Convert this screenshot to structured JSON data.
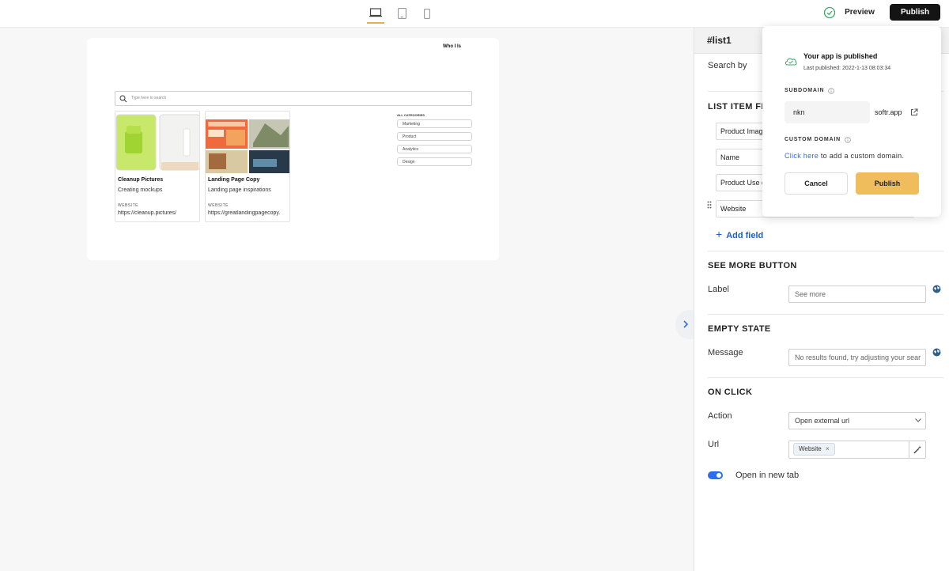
{
  "topbar": {
    "devices": [
      {
        "icon": "desktop-icon",
        "active": true
      },
      {
        "icon": "tablet-icon",
        "active": false
      },
      {
        "icon": "mobile-icon",
        "active": false
      }
    ],
    "status_icon": "check-circle-icon",
    "preview_label": "Preview",
    "publish_label": "Publish"
  },
  "canvas": {
    "header_text": "Who I Is",
    "search_placeholder": "Type here to search",
    "cards": [
      {
        "title": "Cleanup Pictures",
        "subtitle": "Creating mockups",
        "field_label": "WEBSITE",
        "url": "https://cleanup.pictures/"
      },
      {
        "title": "Landing Page Copy",
        "subtitle": "Landing page inspirations",
        "field_label": "WEBSITE",
        "url": "https://greatlandingpagecopy."
      }
    ],
    "categories_header": "ALL CATEGORIES",
    "categories": [
      "Marketing",
      "Product",
      "Analytics",
      "Design"
    ]
  },
  "panel": {
    "title": "#list1",
    "search_by_label": "Search by",
    "list_item_fields_heading": "LIST ITEM FIEL",
    "fields": [
      "Product Imag",
      "Name",
      "Product Use c",
      "Website"
    ],
    "add_field_label": "Add field",
    "see_more": {
      "heading": "SEE MORE BUTTON",
      "label": "Label",
      "value": "See more"
    },
    "empty_state": {
      "heading": "EMPTY STATE",
      "label": "Message",
      "value": "No results found, try adjusting your sear"
    },
    "on_click": {
      "heading": "ON CLICK",
      "action_label": "Action",
      "action_value": "Open external url",
      "url_label": "Url",
      "url_chip": "Website"
    },
    "new_tab_label": "Open in new tab",
    "new_tab_enabled": true
  },
  "popup": {
    "title": "Your app is published",
    "last_published": "Last published: 2022-1-13 08:03:34",
    "subdomain_label": "SUBDOMAIN",
    "subdomain_value": "nkn",
    "domain_suffix": "softr.app",
    "custom_domain_label": "CUSTOM DOMAIN",
    "custom_domain_link": "Click here",
    "custom_domain_text": " to add a custom domain.",
    "cancel_label": "Cancel",
    "publish_label": "Publish"
  },
  "colors": {
    "accent": "#f0bd5d",
    "link": "#2d6ef0",
    "primary_dark": "#141414"
  }
}
